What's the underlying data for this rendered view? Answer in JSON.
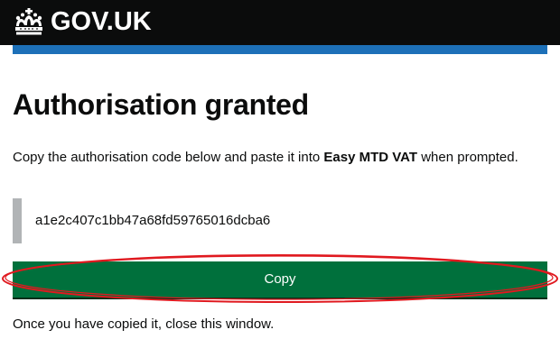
{
  "header": {
    "logo_text": "GOV.UK",
    "logo_icon": "crown-icon",
    "background": "#0b0c0c",
    "accent_bar_color": "#1d70b8"
  },
  "main": {
    "title": "Authorisation granted",
    "instructions_prefix": "Copy the authorisation code below and paste it into ",
    "instructions_app": "Easy MTD VAT",
    "instructions_suffix": " when prompted.",
    "auth_code": "a1e2c407c1bb47a68fd59765016dcba6",
    "copy_button_label": "Copy",
    "copy_button_color": "#00703c",
    "closing_text": "Once you have copied it, close this window."
  },
  "annotation": {
    "highlight_color": "#e0191f",
    "shape": "ellipse-around-copy-button"
  }
}
